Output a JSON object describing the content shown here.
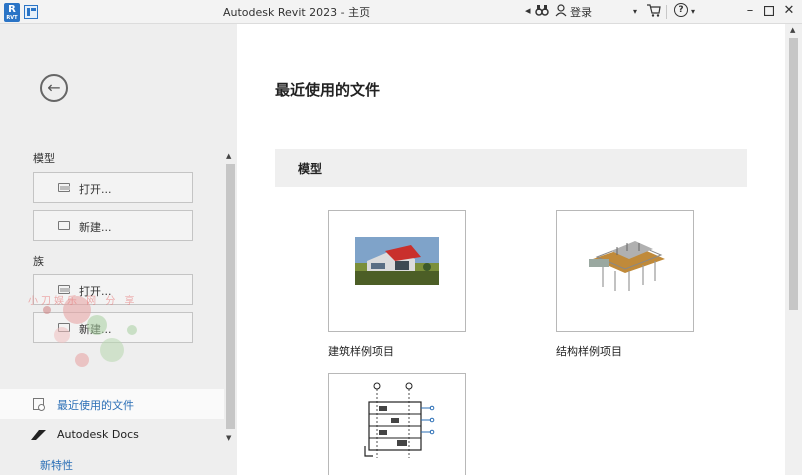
{
  "window": {
    "title": "Autodesk Revit 2023 - 主页",
    "app_logo": "R",
    "app_logo_sub": "RVT",
    "login_label": "登录",
    "help_label": "?"
  },
  "sidebar": {
    "sections": [
      {
        "label": "模型",
        "buttons": [
          "打开...",
          "新建..."
        ]
      },
      {
        "label": "族",
        "buttons": [
          "打开...",
          "新建..."
        ]
      }
    ],
    "nav": [
      {
        "label": "最近使用的文件",
        "active": true
      },
      {
        "label": "Autodesk Docs",
        "active": false
      }
    ],
    "feature_link": "新特性",
    "watermark_text": "小刀娱乐 网 分 享"
  },
  "main": {
    "title": "最近使用的文件",
    "group": "模型",
    "cards": [
      {
        "label": "建筑样例项目",
        "icon": "architectural-sample-thumbnail"
      },
      {
        "label": "结构样例项目",
        "icon": "structural-sample-thumbnail"
      },
      {
        "label": "",
        "icon": "mep-sample-thumbnail"
      }
    ]
  },
  "colors": {
    "accent": "#2b6fb6",
    "sidebar_bg": "#eeeeee",
    "titlebar_bg": "#f3f3f3"
  }
}
